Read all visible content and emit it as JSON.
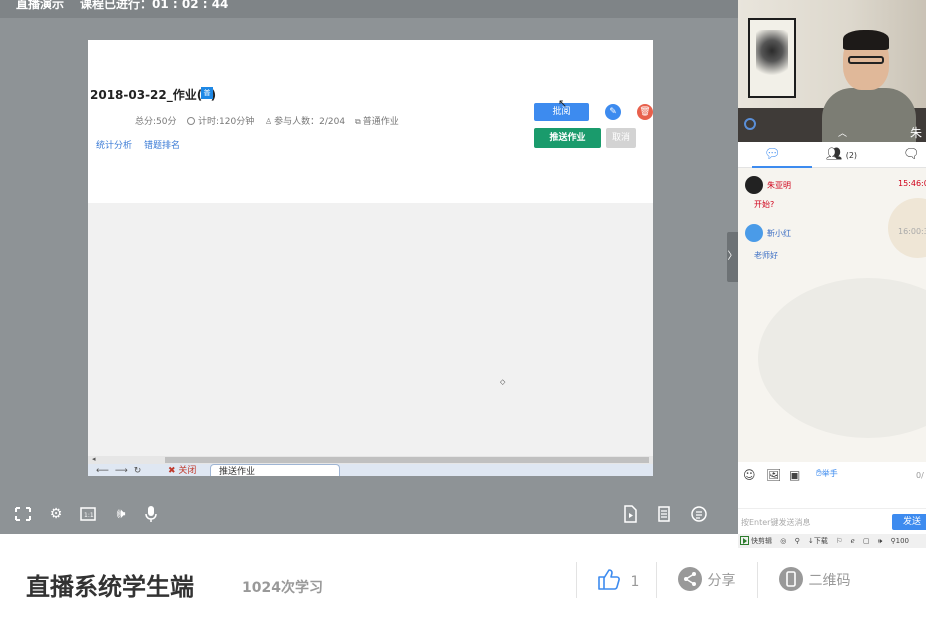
{
  "player": {
    "title": "直播演示",
    "timer_label": "课程已进行：01 : 02 : 44"
  },
  "homework": {
    "title": "2018-03-22_作业(1)",
    "badge": "普",
    "total_score": "总分:50分",
    "time_limit": "计时:120分钟",
    "participants": "参与人数：2/204",
    "type": "普通作业",
    "link_stats": "统计分析",
    "link_wrong": "错题排名",
    "review_button": "批阅",
    "push_button": "推送作业",
    "cancel_button": "取消"
  },
  "slide_tabs": {
    "close_label": "✖ 关闭",
    "active_tab": "推送作业"
  },
  "video": {
    "speaker_name": "朱"
  },
  "chat_panel": {
    "participants_count": "(2)",
    "messages": [
      {
        "name": "朱亚明",
        "time": "15:46:0",
        "text": "开始?",
        "name_color": "#d0021b",
        "time_color": "#d0021b",
        "text_color": "#d0021b"
      },
      {
        "name": "靳小红",
        "time": "16:00:3",
        "text": "老师好",
        "name_color": "#3d6fc4",
        "time_color": "#aaaaaa",
        "text_color": "#3d6fc4"
      }
    ],
    "raise_hand": "举手",
    "counter": "0/",
    "input_placeholder": "按Enter键发送消息",
    "send_button": "发送"
  },
  "browser_statusbar": {
    "items": [
      "快剪辑",
      "下载",
      "100"
    ]
  },
  "course": {
    "title": "直播系统学生端",
    "study_count": "1024次学习",
    "like_count": "1",
    "share_label": "分享",
    "qrcode_label": "二维码"
  },
  "colors": {
    "primary": "#3d8bef",
    "push_green": "#1a9b6c",
    "delete_red": "#e8604c",
    "player_bg": "#8e9396"
  }
}
